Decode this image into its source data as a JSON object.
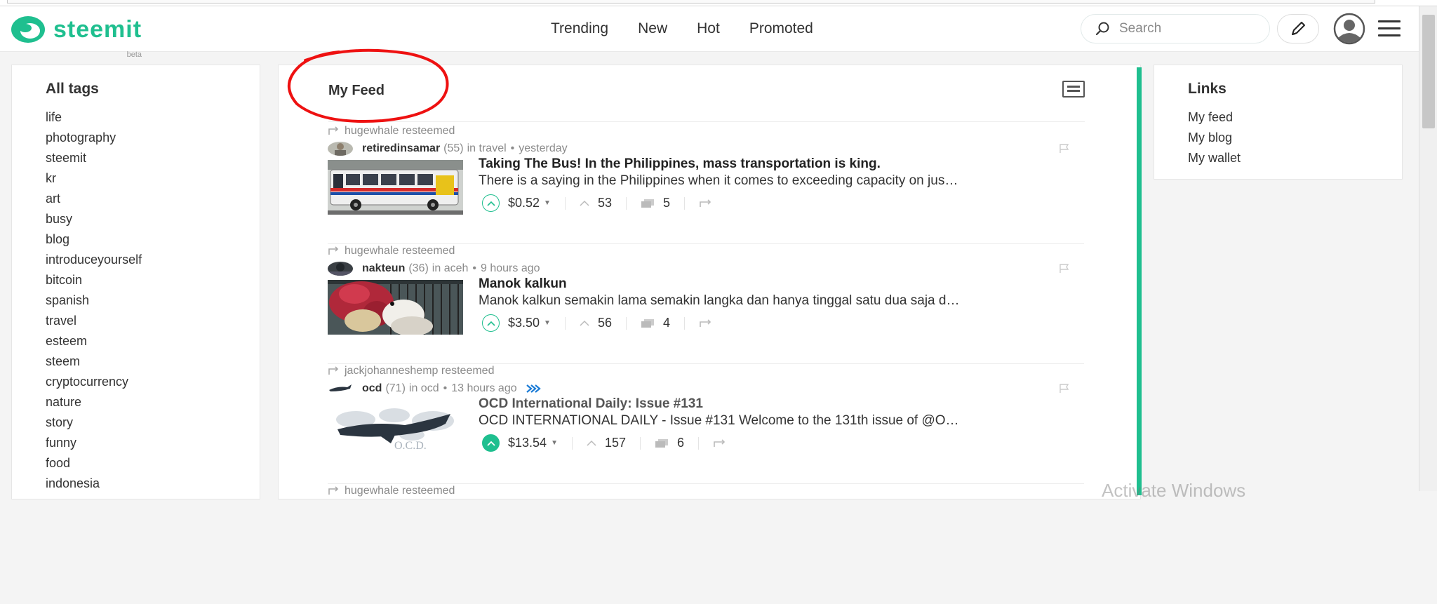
{
  "header": {
    "logo_text": "steemit",
    "logo_badge": "beta",
    "nav": [
      "Trending",
      "New",
      "Hot",
      "Promoted"
    ],
    "search_placeholder": "Search",
    "accent_color": "#1fbf8f"
  },
  "tags_panel": {
    "title": "All tags",
    "tags": [
      "life",
      "photography",
      "steemit",
      "kr",
      "art",
      "busy",
      "blog",
      "introduceyourself",
      "bitcoin",
      "spanish",
      "travel",
      "esteem",
      "steem",
      "cryptocurrency",
      "nature",
      "story",
      "funny",
      "food",
      "indonesia"
    ]
  },
  "feed": {
    "title": "My Feed",
    "posts": [
      {
        "resteem": "hugewhale resteemed",
        "author": "retiredinsamar",
        "rep": "(55)",
        "category": "in travel",
        "time": "yesterday",
        "title": "Taking The Bus! In the Philippines, mass transportation is king.",
        "summary": "There is a saying in the Philippines when it comes to exceeding capacity on jus…",
        "payout": "$0.52",
        "votes": "53",
        "comments": "5"
      },
      {
        "resteem": "hugewhale resteemed",
        "author": "nakteun",
        "rep": "(36)",
        "category": "in aceh",
        "time": "9 hours ago",
        "title": "Manok kalkun",
        "summary": "Manok kalkun semakin lama semakin langka dan hanya tinggal satu dua saja d…",
        "payout": "$3.50",
        "votes": "56",
        "comments": "4"
      },
      {
        "resteem": "jackjohanneshemp resteemed",
        "author": "ocd",
        "rep": "(71)",
        "category": "in ocd",
        "time": "13 hours ago",
        "title": "OCD International Daily: Issue #131",
        "summary": "OCD INTERNATIONAL DAILY - Issue #131 Welcome to the 131th issue of @O…",
        "payout": "$13.54",
        "votes": "157",
        "comments": "6",
        "thumb_label": "O.C.D."
      },
      {
        "resteem": "hugewhale resteemed"
      }
    ]
  },
  "links_panel": {
    "title": "Links",
    "links": [
      "My feed",
      "My blog",
      "My wallet"
    ]
  },
  "watermark": "Activate Windows"
}
